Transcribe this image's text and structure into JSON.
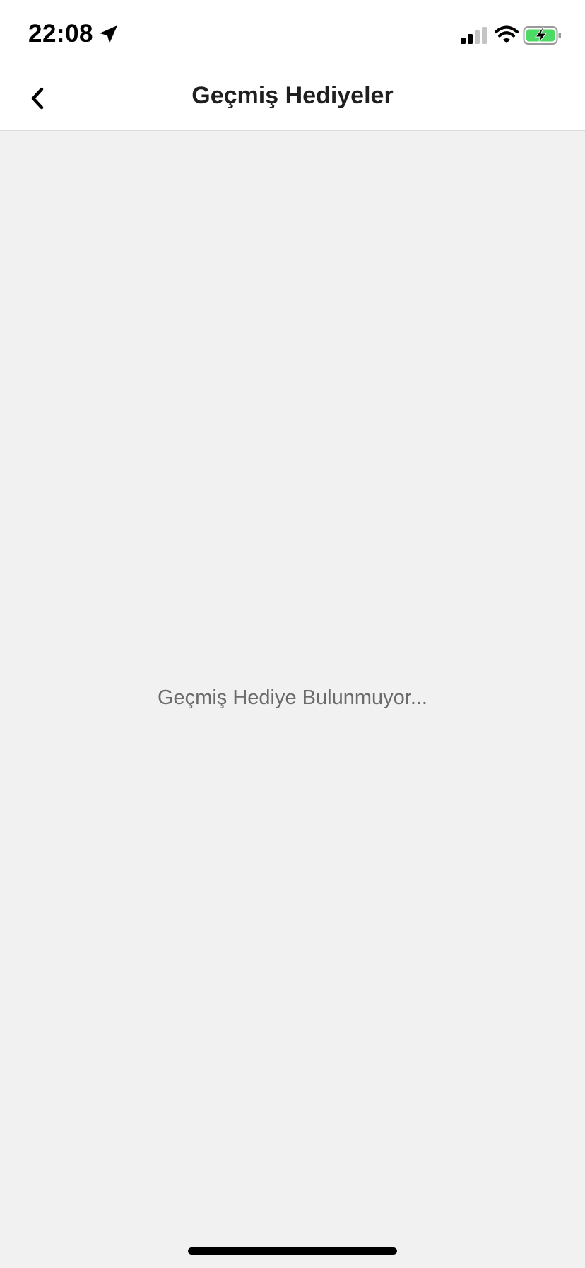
{
  "status_bar": {
    "time": "22:08",
    "location_icon": "location-arrow-icon",
    "signal_icon": "cellular-signal-icon",
    "wifi_icon": "wifi-icon",
    "battery_icon": "battery-charging-icon",
    "battery_color": "#4cd964"
  },
  "nav": {
    "back_icon": "chevron-left-icon",
    "title": "Geçmiş Hediyeler"
  },
  "content": {
    "empty_message": "Geçmiş Hediye Bulunmuyor..."
  },
  "colors": {
    "background": "#f1f1f1",
    "header": "#ffffff",
    "message_text": "#6b6b6b"
  }
}
